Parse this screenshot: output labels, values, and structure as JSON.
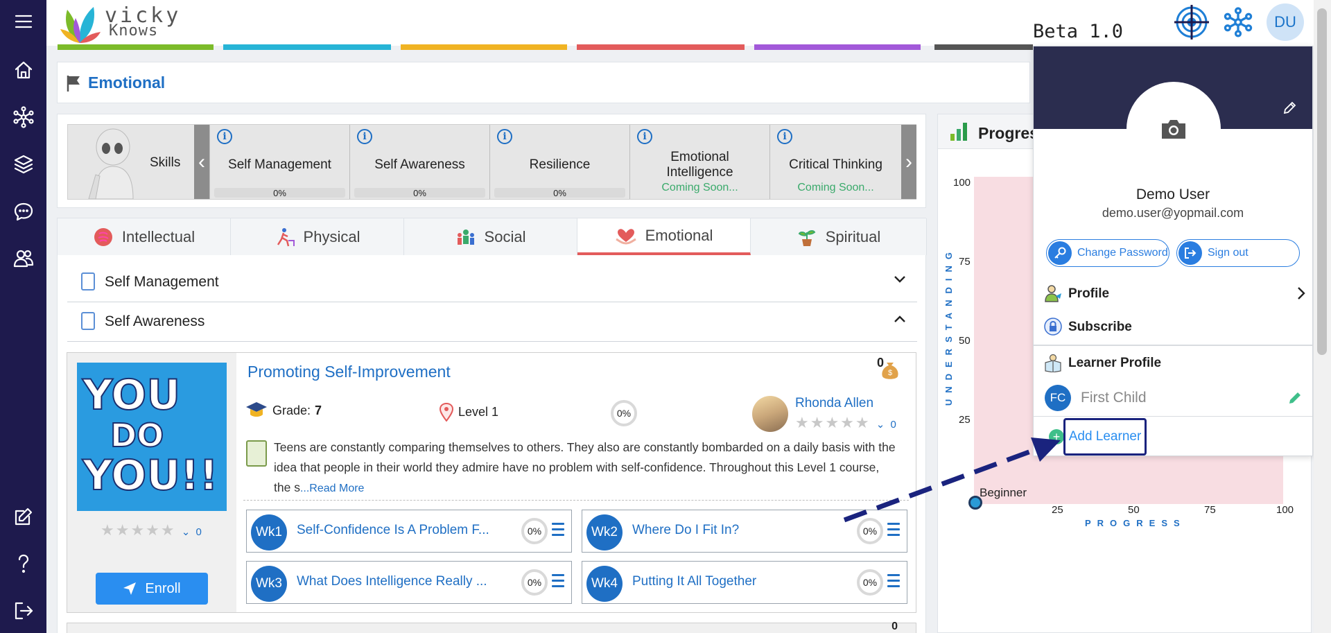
{
  "app": {
    "logo_line1": "vicky",
    "logo_line2": "Knows",
    "beta_label": "Beta 1.0",
    "user_initials": "DU",
    "color_strip": [
      "#7cbb2a",
      "#27b4d6",
      "#f0b323",
      "#e35b5b",
      "#a259d9",
      "#555555"
    ]
  },
  "sidebar": {
    "items": [
      {
        "name": "menu-icon"
      },
      {
        "name": "home-icon"
      },
      {
        "name": "network-icon"
      },
      {
        "name": "layers-icon"
      },
      {
        "name": "chat-icon"
      },
      {
        "name": "users-icon"
      },
      {
        "name": "edit-icon"
      },
      {
        "name": "help-icon"
      },
      {
        "name": "logout-icon"
      }
    ]
  },
  "breadcrumb": {
    "title": "Emotional"
  },
  "skills": {
    "label": "Skills",
    "items": [
      {
        "name": "Self Management",
        "progress": "0%",
        "status": ""
      },
      {
        "name": "Self Awareness",
        "progress": "0%",
        "status": ""
      },
      {
        "name": "Resilience",
        "progress": "0%",
        "status": ""
      },
      {
        "name": "Emotional Intelligence",
        "progress": "",
        "status": "Coming Soon..."
      },
      {
        "name": "Critical Thinking",
        "progress": "",
        "status": "Coming Soon..."
      }
    ]
  },
  "categories": {
    "tabs": [
      {
        "label": "Intellectual",
        "active": false
      },
      {
        "label": "Physical",
        "active": false
      },
      {
        "label": "Social",
        "active": false
      },
      {
        "label": "Emotional",
        "active": true
      },
      {
        "label": "Spiritual",
        "active": false
      }
    ]
  },
  "accordion": {
    "items": [
      {
        "label": "Self Management",
        "expanded": false
      },
      {
        "label": "Self Awareness",
        "expanded": true
      }
    ]
  },
  "course": {
    "cover_text": [
      "YOU",
      "DO",
      "YOU!!"
    ],
    "title": "Promoting Self-Improvement",
    "coins": "0",
    "grade_label": "Grade:",
    "grade_value": "7",
    "level": "Level 1",
    "progress": "0%",
    "rating_count": "0",
    "teacher": {
      "name": "Rhonda Allen",
      "rating_count": "0"
    },
    "description": "Teens are constantly comparing themselves to others. They also are constantly bombarded on a daily basis with the idea that people in their world they admire have no problem with self-confidence. Throughout this Level 1 course, the s",
    "read_more": "...Read More",
    "enroll_label": "Enroll",
    "weeks": [
      {
        "badge": "Wk1",
        "title": "Self-Confidence Is A Problem F...",
        "progress": "0%"
      },
      {
        "badge": "Wk2",
        "title": "Where Do I Fit In?",
        "progress": "0%"
      },
      {
        "badge": "Wk3",
        "title": "What Does Intelligence Really ...",
        "progress": "0%"
      },
      {
        "badge": "Wk4",
        "title": "Putting It All Together",
        "progress": "0%"
      }
    ],
    "next_card_coins": "0"
  },
  "progress_panel": {
    "title": "Progres",
    "y_axis_title": "UNDERSTANDING",
    "x_axis_title": "PROGRESS",
    "y_ticks": [
      "100",
      "75",
      "50",
      "25"
    ],
    "x_ticks": [
      "25",
      "50",
      "75",
      "100"
    ],
    "marker_label": "Beginner"
  },
  "profile_menu": {
    "name": "Demo User",
    "email": "demo.user@yopmail.com",
    "change_password": "Change Password",
    "sign_out": "Sign out",
    "profile": "Profile",
    "subscribe": "Subscribe",
    "learner_profile": "Learner Profile",
    "learner": {
      "initials": "FC",
      "name": "First Child"
    },
    "add_learner": "Add Learner"
  }
}
